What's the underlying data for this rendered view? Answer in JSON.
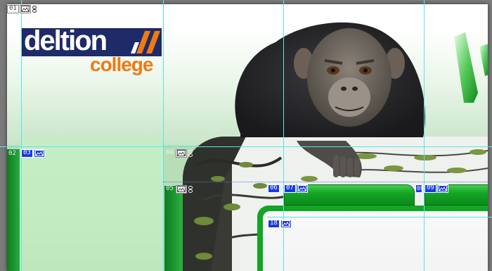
{
  "logo": {
    "name": "deltion",
    "subtitle": "college",
    "colors": {
      "bar": "#1f2a68",
      "subtitle": "#f07a12",
      "slashes": "#f07a12"
    }
  },
  "slices": [
    {
      "id": "01",
      "kind": "auto",
      "icons": [
        "image-icon",
        "link-icon"
      ]
    },
    {
      "id": "02",
      "kind": "auto",
      "icons": []
    },
    {
      "id": "03",
      "kind": "user",
      "icons": [
        "image-icon"
      ]
    },
    {
      "id": "04",
      "kind": "auto",
      "icons": [
        "image-icon",
        "link-icon"
      ]
    },
    {
      "id": "05",
      "kind": "auto",
      "icons": [
        "image-icon",
        "link-icon"
      ]
    },
    {
      "id": "06",
      "kind": "user",
      "icons": []
    },
    {
      "id": "07",
      "kind": "user",
      "icons": [
        "image-icon"
      ]
    },
    {
      "id": "08",
      "kind": "user",
      "icons": []
    },
    {
      "id": "09",
      "kind": "user",
      "icons": [
        "image-icon"
      ]
    },
    {
      "id": "18",
      "kind": "user",
      "icons": [
        "image-icon"
      ]
    }
  ],
  "colors": {
    "guide": "#55e6ea",
    "user_slice": "#1a3adf",
    "tab_green": "#15a525",
    "panel_green": "#c6eec6"
  }
}
